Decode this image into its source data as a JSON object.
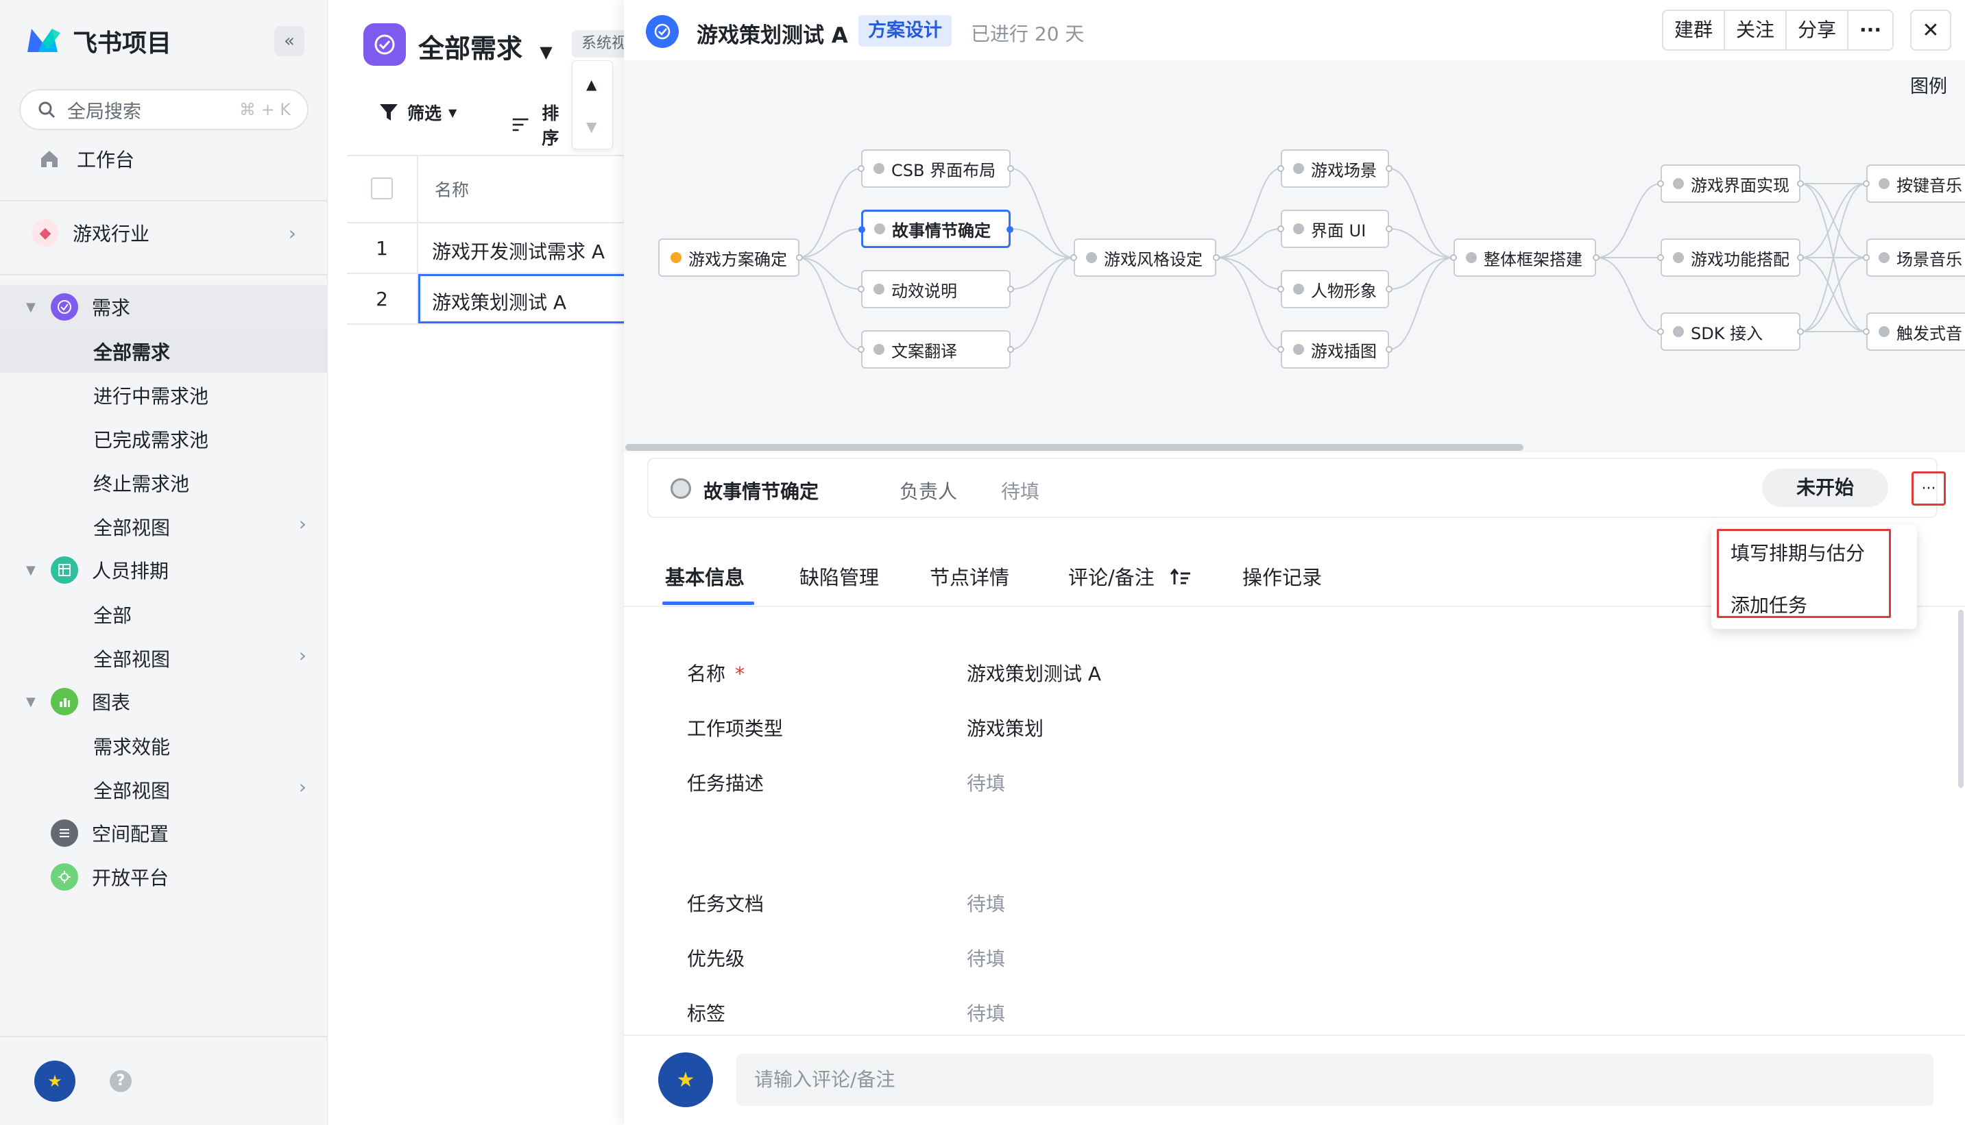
{
  "app": {
    "name": "飞书项目"
  },
  "sidebar": {
    "search": {
      "placeholder": "全局搜索",
      "shortcut": "⌘ + K"
    },
    "workbench": "工作台",
    "space": "游戏行业",
    "groups": [
      {
        "label": "需求",
        "color": "#7f5af0",
        "items": [
          "全部需求",
          "进行中需求池",
          "已完成需求池",
          "终止需求池",
          "全部视图"
        ]
      },
      {
        "label": "人员排期",
        "color": "#2fbf9f",
        "items": [
          "全部",
          "全部视图"
        ]
      },
      {
        "label": "图表",
        "color": "#5cc34f",
        "items": [
          "需求效能",
          "全部视图"
        ]
      }
    ],
    "space_config": "空间配置",
    "open_platform": "开放平台",
    "active_item": "全部需求"
  },
  "list": {
    "title": "全部需求",
    "view_badge": "系统视图",
    "toolbar": {
      "filter": "筛选",
      "sort": "排序"
    },
    "columns": {
      "name": "名称"
    },
    "rows": [
      {
        "num": "1",
        "name": "游戏开发测试需求 A"
      },
      {
        "num": "2",
        "name": "游戏策划测试 A"
      }
    ]
  },
  "detail": {
    "title": "游戏策划测试 A",
    "stage_tag": "方案设计",
    "progress": "已进行 20 天",
    "actions": [
      "建群",
      "关注",
      "分享",
      "···"
    ],
    "legend": "图例",
    "flow_nodes": {
      "n1": "游戏方案确定",
      "n2": "CSB 界面布局",
      "n3": "故事情节确定",
      "n4": "动效说明",
      "n5": "文案翻译",
      "n6": "游戏风格设定",
      "n7": "游戏场景",
      "n8": "界面 UI",
      "n9": "人物形象",
      "n10": "游戏插图",
      "n11": "整体框架搭建",
      "n12": "游戏界面实现",
      "n13": "游戏功能搭配",
      "n14": "SDK 接入",
      "n15": "按键音乐",
      "n16": "场景音乐",
      "n17": "触发式音"
    },
    "node_bar": {
      "name": "故事情节确定",
      "owner_label": "负责人",
      "owner_value": "待填",
      "status": "未开始"
    },
    "menu": [
      "填写排期与估分",
      "添加任务"
    ],
    "tabs": [
      "基本信息",
      "缺陷管理",
      "节点详情",
      "评论/备注",
      "操作记录"
    ],
    "fields": [
      {
        "label": "名称",
        "value": "游戏策划测试 A"
      },
      {
        "label": "工作项类型",
        "value": "游戏策划"
      },
      {
        "label": "任务描述",
        "value": "待填"
      },
      {
        "label": "任务文档",
        "value": "待填"
      },
      {
        "label": "优先级",
        "value": "待填"
      },
      {
        "label": "标签",
        "value": "待填"
      }
    ],
    "comment_placeholder": "请输入评论/备注"
  },
  "colors": {
    "accent": "#3370ff",
    "highlight": "#e03a3a",
    "current_node_dot": "#f5a623"
  }
}
